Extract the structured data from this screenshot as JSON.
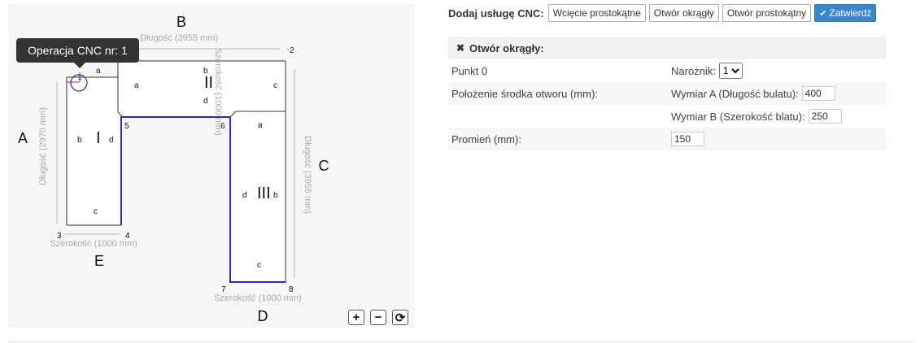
{
  "canvas": {
    "tooltip": "Operacja CNC nr: 1",
    "side_labels": {
      "a": "A",
      "b": "B",
      "c": "C",
      "d": "D",
      "e": "E"
    },
    "dims": {
      "top_length": "Długość (3955 mm)",
      "left_length": "Długość (2970 mm)",
      "right_length": "Długość (3955 mm)",
      "middle_width": "Szerokość (1000 mm)",
      "bottom_left_width": "Szerokość (1000 mm)",
      "bottom_right_width": "Szerokość (1000 mm)"
    },
    "points": {
      "p1": "1",
      "p2": "2",
      "p3": "3",
      "p4": "4",
      "p5": "5",
      "p6": "6",
      "p7": "7",
      "p8": "8"
    },
    "panels": {
      "i": {
        "numeral": "I",
        "a": "a",
        "b": "b",
        "c": "c",
        "d": "d"
      },
      "ii": {
        "numeral": "II",
        "a": "a",
        "b": "b",
        "c": "c",
        "d": "d"
      },
      "iii": {
        "numeral": "III",
        "a": "a",
        "b": "b",
        "c": "c",
        "d": "d"
      }
    },
    "zoom": {
      "in": "+",
      "out": "−",
      "reset": "⟳"
    },
    "icons": {
      "zoom_in": "plus-icon",
      "zoom_out": "minus-icon",
      "reset": "refresh-icon"
    }
  },
  "toolbar": {
    "label": "Dodaj usługę CNC:",
    "buttons": [
      "Wcięcie prostokątne",
      "Otwór okrągły",
      "Otwór prostokątny"
    ],
    "confirm": "Zatwierdź",
    "confirm_icon": "check-icon"
  },
  "form": {
    "title": "Otwór okrągły:",
    "close_icon": "close-icon",
    "rows": {
      "point": "Punkt 0",
      "corner_label": "Narożnik:",
      "corner_value": "1",
      "center_label": "Położenie środka otworu (mm):",
      "dim_a_label": "Wymiar A (Długość bulatu):",
      "dim_a_value": "400",
      "dim_b_label": "Wymiar B (Szerokość blatu):",
      "dim_b_value": "250",
      "radius_label": "Promień (mm):",
      "radius_value": "150"
    }
  },
  "colors": {
    "highlight": "#1f2fb0",
    "marker": "#cc2244",
    "primary": "#3a86d0"
  }
}
